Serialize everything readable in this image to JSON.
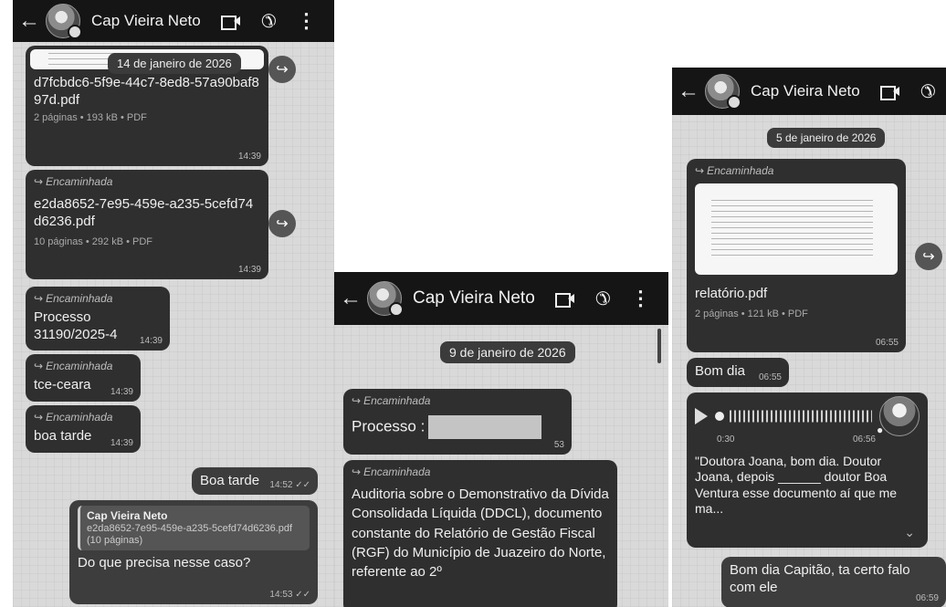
{
  "phone1": {
    "header": {
      "contact_name": "Cap Vieira Neto"
    },
    "date_pill": "14 de janeiro de 2026",
    "file_msg_1": {
      "filename": "d7fcbdc6-5f9e-44c7-8ed8-57a90baf897d.pdf",
      "meta": "2 páginas • 193 kB • PDF",
      "time": "14:39"
    },
    "file_msg_2": {
      "forwarded": "Encaminhada",
      "filename": "e2da8652-7e95-459e-a235-5cefd74d6236.pdf",
      "meta": "10 páginas • 292 kB • PDF",
      "time": "14:39"
    },
    "msg_processo": {
      "forwarded": "Encaminhada",
      "text": "Processo 31190/2025-4",
      "time": "14:39"
    },
    "msg_tce": {
      "forwarded": "Encaminhada",
      "text": "tce-ceara",
      "time": "14:39"
    },
    "msg_boa_tarde": {
      "forwarded": "Encaminhada",
      "text": "boa tarde",
      "time": "14:39"
    },
    "sent_boa_tarde": {
      "text": "Boa tarde",
      "time": "14:52",
      "status": "✓✓"
    },
    "reply_msg": {
      "quote_name": "Cap Vieira Neto",
      "quote_text": "e2da8652-7e95-459e-a235-5cefd74d6236.pdf (10 páginas)",
      "text": "Do que precisa nesse caso?",
      "time": "14:53",
      "status": "✓✓"
    }
  },
  "phone2": {
    "header": {
      "contact_name": "Cap Vieira Neto"
    },
    "date_pill": "9 de janeiro de 2026",
    "msg_processo": {
      "forwarded": "Encaminhada",
      "text": "Processo :",
      "time": "53"
    },
    "msg_auditoria": {
      "forwarded": "Encaminhada",
      "text": "Auditoria sobre o Demonstrativo da Dívida Consolidada Líquida (DDCL), documento constante do Relatório de Gestão Fiscal (RGF) do Município de Juazeiro do Norte, referente ao 2º"
    }
  },
  "phone3": {
    "header": {
      "contact_name": "Cap Vieira Neto"
    },
    "date_pill": "5 de janeiro de 2026",
    "file_msg": {
      "forwarded": "Encaminhada",
      "filename": "relatório.pdf",
      "meta": "2 páginas • 121 kB • PDF",
      "time": "06:55"
    },
    "msg_bom_dia": {
      "text": "Bom dia",
      "time": "06:55"
    },
    "voice_msg": {
      "duration": "0:30",
      "time": "06:56",
      "transcript": "\"Doutora Joana, bom dia. Doutor Joana, depois ______ doutor Boa Ventura esse documento aí que me ma..."
    },
    "sent_msg": {
      "text": "Bom dia Capitão, ta certo falo com ele",
      "time": "06:59"
    }
  },
  "icons": {
    "back": "←",
    "call": "✆",
    "menu": "⋮",
    "forward_button": "↪",
    "forward_tag": "↪",
    "expand": "⌄"
  }
}
